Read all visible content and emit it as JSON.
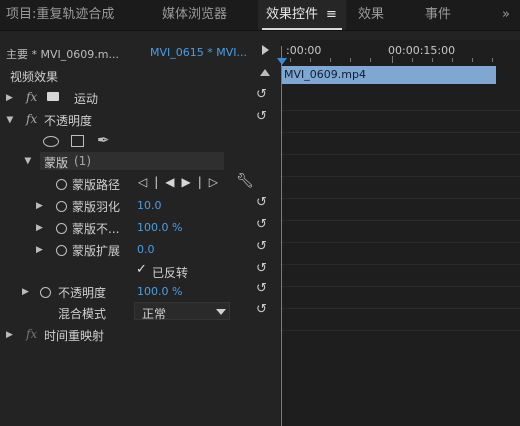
{
  "tabs": [
    {
      "label": "项目:重复轨迹合成"
    },
    {
      "label": "媒体浏览器"
    },
    {
      "label": "效果控件"
    },
    {
      "label": "效果"
    },
    {
      "label": "事件"
    }
  ],
  "tab_menu_icon": "≡",
  "overflow_icon": "»",
  "source": {
    "master": "主要 * MVI_0609.m...",
    "clip": "MVI_0615 * MVI..."
  },
  "timeline": {
    "tc_start": ":00:00",
    "tc_mid": "00:00:15:00",
    "clip_name": "MVI_0609.mp4"
  },
  "panel_title": "视频效果",
  "effects": {
    "motion": "运动",
    "opacity": "不透明度",
    "mask": "蒙版",
    "mask_count": "(1)",
    "mask_path": "蒙版路径",
    "mask_feather": "蒙版羽化",
    "mask_feather_value": "10.0",
    "mask_opacity": "蒙版不...",
    "mask_opacity_value": "100.0 %",
    "mask_expansion": "蒙版扩展",
    "mask_expansion_value": "0.0",
    "inverted_label": "已反转",
    "inverted_checked": true,
    "opacity_prop": "不透明度",
    "opacity_value": "100.0 %",
    "blend_mode_label": "混合模式",
    "blend_mode_value": "正常",
    "time_remap": "时间重映射"
  },
  "colors": {
    "accent_blue": "#4a9ee6",
    "clip_fill": "#7fa7d1",
    "playhead": "#3a8ad8"
  }
}
